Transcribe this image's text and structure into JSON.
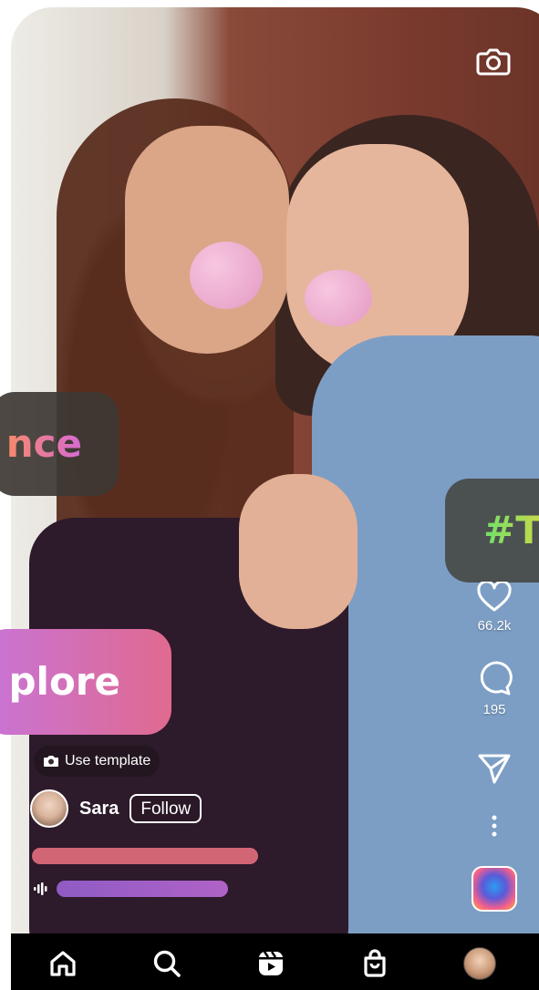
{
  "stickers": {
    "trance": "nce",
    "hashtag": "#T",
    "explore": "plore"
  },
  "actions": {
    "likes": "66.2k",
    "comments": "195"
  },
  "reel": {
    "use_template": "Use template",
    "username": "Sara",
    "follow_label": "Follow"
  },
  "icons": {
    "camera": "camera-icon",
    "like": "heart-icon",
    "comment": "comment-icon",
    "share": "send-icon",
    "more": "more-vertical-icon",
    "nav": [
      "home-icon",
      "search-icon",
      "reels-icon",
      "shop-icon",
      "profile-avatar"
    ]
  },
  "colors": {
    "sticker_trance": "#e07aa0",
    "sticker_hashtag": "#8fe05a",
    "sticker_explore": "#d26fbb",
    "caption_bar": "#d26574",
    "audio_bar": "#9a5ec6",
    "nav_background": "#000000"
  }
}
